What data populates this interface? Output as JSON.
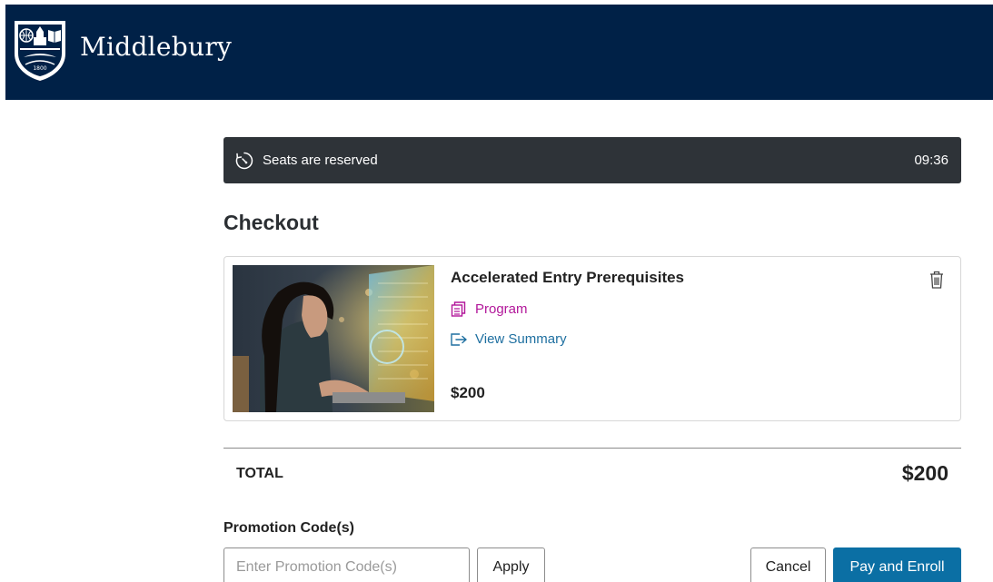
{
  "brand": {
    "name": "Middlebury",
    "seal_year": "1800",
    "colors": {
      "header_bg": "#002147",
      "accent": "#0b6fa4",
      "program": "#b2179a",
      "link": "#1e6fa0"
    }
  },
  "reservation": {
    "label": "Seats are reserved",
    "time_remaining": "09:36",
    "icon": "timer-icon"
  },
  "checkout": {
    "title": "Checkout",
    "items": [
      {
        "title": "Accelerated Entry Prerequisites",
        "type_label": "Program",
        "type_icon": "stacked-pages-icon",
        "summary_label": "View Summary",
        "summary_icon": "external-link-icon",
        "price": "$200",
        "remove_icon": "trash-icon"
      }
    ],
    "total_label": "TOTAL",
    "total_value": "$200"
  },
  "promo": {
    "label": "Promotion Code(s)",
    "placeholder": "Enter Promotion Code(s)",
    "value": "",
    "apply_label": "Apply"
  },
  "actions": {
    "cancel_label": "Cancel",
    "pay_label": "Pay and Enroll"
  }
}
